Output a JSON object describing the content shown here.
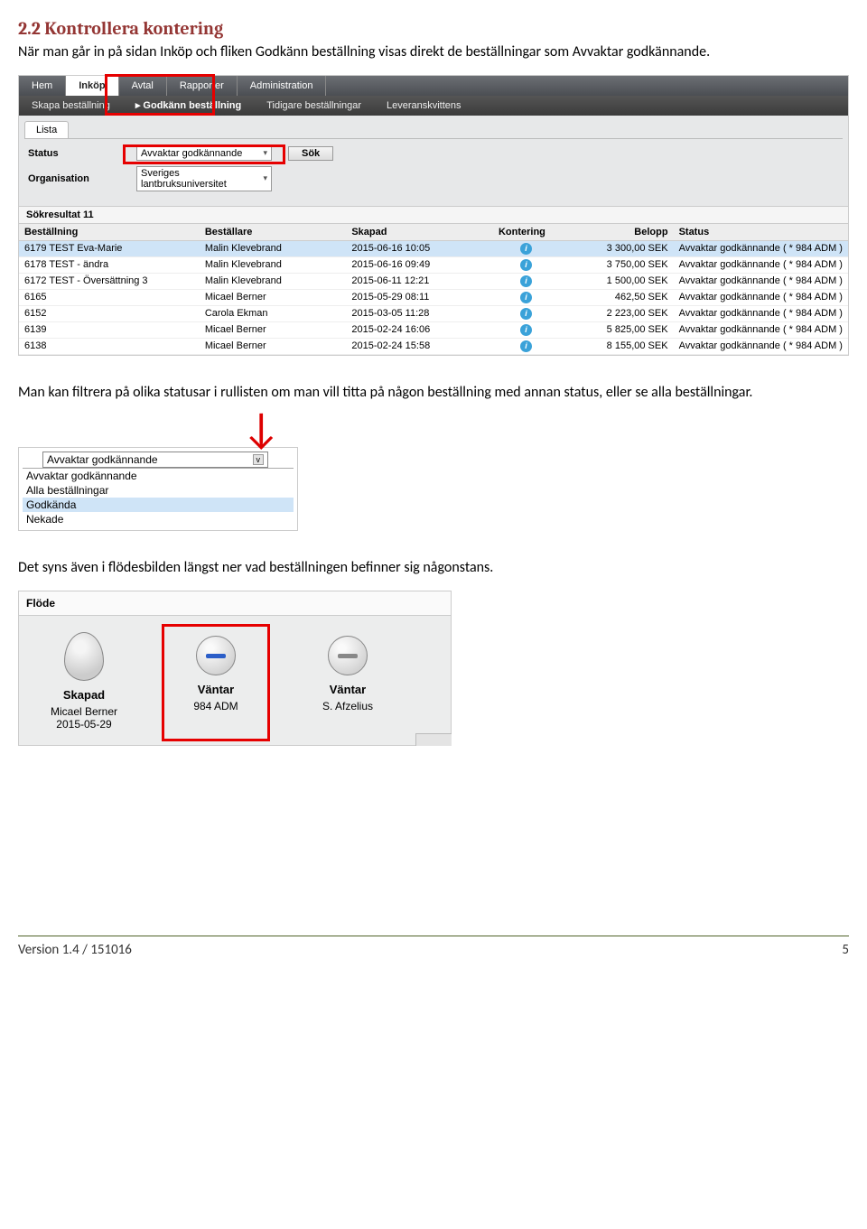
{
  "heading": "2.2 Kontrollera kontering",
  "para1": "När man går in på sidan Inköp och fliken Godkänn beställning visas direkt de beställningar som Avvaktar godkännande.",
  "para2": "Man kan filtrera på olika statusar i rullisten om man vill titta på någon beställning med annan status, eller se alla beställningar.",
  "para3": "Det syns även i flödesbilden längst ner vad beställningen befinner sig någonstans.",
  "ss1": {
    "nav": {
      "items": [
        "Hem",
        "Inköp",
        "Avtal",
        "Rapporter",
        "Administration"
      ],
      "active_index": 1
    },
    "subnav": {
      "items": [
        "Skapa beställning",
        "Godkänn beställning",
        "Tidigare beställningar",
        "Leveranskvittens"
      ],
      "active_index": 1
    },
    "listtab": "Lista",
    "status_label": "Status",
    "status_value": "Avvaktar godkännande",
    "org_label": "Organisation",
    "org_value": "Sveriges lantbruksuniversitet",
    "search_btn": "Sök",
    "result_title": "Sökresultat 11",
    "columns": [
      "Beställning",
      "Beställare",
      "Skapad",
      "Kontering",
      "Belopp",
      "Status"
    ],
    "rows": [
      {
        "b": "6179 TEST Eva-Marie",
        "be": "Malin Klevebrand",
        "d": "2015-06-16 10:05",
        "amt": "3 300,00 SEK",
        "st": "Avvaktar godkännande  ( * 984 ADM )"
      },
      {
        "b": "6178 TEST - ändra",
        "be": "Malin Klevebrand",
        "d": "2015-06-16 09:49",
        "amt": "3 750,00 SEK",
        "st": "Avvaktar godkännande  ( * 984 ADM )"
      },
      {
        "b": "6172 TEST - Översättning 3",
        "be": "Malin Klevebrand",
        "d": "2015-06-11 12:21",
        "amt": "1 500,00 SEK",
        "st": "Avvaktar godkännande  ( * 984 ADM )"
      },
      {
        "b": "6165",
        "be": "Micael Berner",
        "d": "2015-05-29 08:11",
        "amt": "462,50 SEK",
        "st": "Avvaktar godkännande  ( * 984 ADM )"
      },
      {
        "b": "6152",
        "be": "Carola Ekman",
        "d": "2015-03-05 11:28",
        "amt": "2 223,00 SEK",
        "st": "Avvaktar godkännande  ( * 984 ADM )"
      },
      {
        "b": "6139",
        "be": "Micael Berner",
        "d": "2015-02-24 16:06",
        "amt": "5 825,00 SEK",
        "st": "Avvaktar godkännande  ( * 984 ADM )"
      },
      {
        "b": "6138",
        "be": "Micael Berner",
        "d": "2015-02-24 15:58",
        "amt": "8 155,00 SEK",
        "st": "Avvaktar godkännande  ( * 984 ADM )"
      }
    ]
  },
  "dropdown": {
    "selected": "Avvaktar godkännande",
    "options": [
      "Avvaktar godkännande",
      "Alla beställningar",
      "Godkända",
      "Nekade"
    ],
    "highlight_index": 2
  },
  "flow": {
    "title": "Flöde",
    "steps": [
      {
        "title": "Skapad",
        "l1": "Micael Berner",
        "l2": "2015-05-29"
      },
      {
        "title": "Väntar",
        "l1": "984 ADM",
        "l2": ""
      },
      {
        "title": "Väntar",
        "l1": "S. Afzelius",
        "l2": ""
      }
    ]
  },
  "footer": {
    "left": "Version 1.4 / 151016",
    "right": "5"
  }
}
